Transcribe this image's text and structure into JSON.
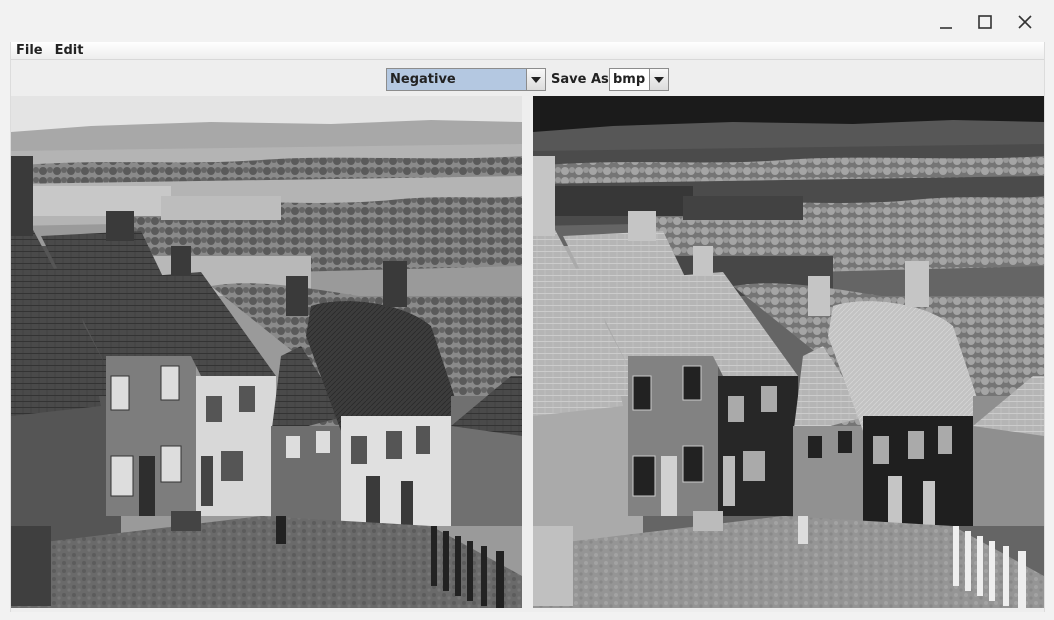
{
  "window": {
    "controls": {
      "minimize_icon": "minimize-icon",
      "maximize_icon": "maximize-icon",
      "close_icon": "close-icon"
    }
  },
  "menubar": {
    "items": [
      {
        "label": "File"
      },
      {
        "label": "Edit"
      }
    ]
  },
  "toolbar": {
    "filter_select": {
      "selected": "Negative",
      "icon": "chevron-down-icon"
    },
    "save_as_label": "Save As",
    "format_select": {
      "selected": "bmp",
      "icon": "chevron-down-icon"
    }
  },
  "images": {
    "original": {
      "kind": "grayscale photo of a hillside village street with thatched cottages"
    },
    "processed": {
      "kind": "negative of the same photo"
    }
  },
  "colors": {
    "selection": "#b4c8e1",
    "frame": "#eeeeee",
    "text": "#222222"
  }
}
